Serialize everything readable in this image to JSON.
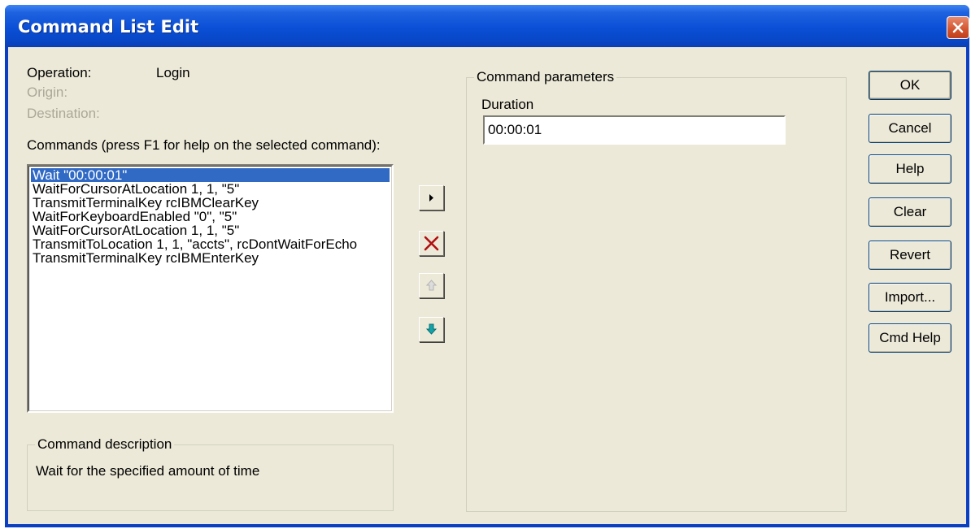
{
  "window": {
    "title": "Command List Edit"
  },
  "info": {
    "operation_label": "Operation:",
    "operation_value": "Login",
    "origin_label": "Origin:",
    "destination_label": "Destination:"
  },
  "commands": {
    "label": "Commands (press F1 for help on the selected command):",
    "items": [
      "Wait \"00:00:01\"",
      "WaitForCursorAtLocation 1, 1, \"5\"",
      "TransmitTerminalKey rcIBMClearKey",
      "WaitForKeyboardEnabled \"0\", \"5\"",
      "WaitForCursorAtLocation 1, 1, \"5\"",
      "TransmitToLocation 1, 1, \"accts\", rcDontWaitForEcho",
      "TransmitTerminalKey rcIBMEnterKey"
    ],
    "selected_index": 0
  },
  "description": {
    "title": "Command description",
    "text": "Wait for the specified amount of time"
  },
  "parameters": {
    "title": "Command parameters",
    "duration_label": "Duration",
    "duration_value": "00:00:01"
  },
  "toolbar": {
    "insert_icon": "arrow-right-icon",
    "delete_icon": "delete-x-icon",
    "move_up_icon": "arrow-up-icon",
    "move_down_icon": "arrow-down-icon"
  },
  "buttons": {
    "ok": "OK",
    "cancel": "Cancel",
    "help": "Help",
    "clear": "Clear",
    "revert": "Revert",
    "import": "Import...",
    "cmd_help": "Cmd Help"
  },
  "colors": {
    "title_bar": "#0a4fd6",
    "dialog_bg": "#ece9d8",
    "selection": "#316ac5",
    "close_button": "#d2532d"
  }
}
